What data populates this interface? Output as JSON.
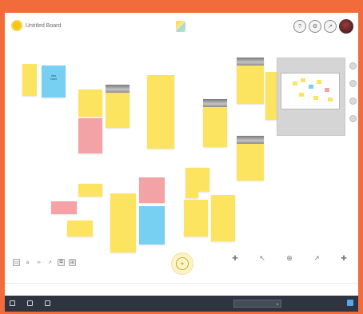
{
  "header": {
    "board_name": "Untitled Board",
    "logo_icon": "smiley-logo-icon",
    "center_logo_icon": "sticky-notes-app-icon",
    "buttons": [
      {
        "name": "help-icon",
        "glyph": "?"
      },
      {
        "name": "settings-icon",
        "glyph": "⚙"
      },
      {
        "name": "share-icon",
        "glyph": "↗"
      }
    ],
    "avatar": "user-avatar"
  },
  "canvas": {
    "notes": [
      {
        "id": "n1",
        "color": "yellow",
        "lines": [
          "",
          "",
          ""
        ]
      },
      {
        "id": "n2",
        "color": "blue",
        "lines": [
          "Idea",
          "board",
          ""
        ]
      },
      {
        "id": "n3",
        "color": "yellow",
        "lines": [
          "",
          "",
          "",
          ""
        ]
      },
      {
        "id": "n4",
        "color": "yellow",
        "lines": [
          "",
          "",
          ""
        ]
      },
      {
        "id": "n5",
        "color": "pink",
        "lines": [
          "",
          "",
          "",
          ""
        ]
      },
      {
        "id": "n6",
        "color": "yellow",
        "lines": [
          "",
          "",
          "",
          "",
          "",
          ""
        ]
      },
      {
        "id": "n7",
        "color": "yellow",
        "lines": [
          "",
          "",
          ""
        ]
      },
      {
        "id": "n8",
        "color": "yellow",
        "lines": [
          "",
          "",
          "",
          ""
        ]
      },
      {
        "id": "n9",
        "color": "yellow",
        "lines": [
          "",
          "",
          ""
        ]
      },
      {
        "id": "n10",
        "color": "yellow",
        "lines": [
          "",
          "",
          ""
        ]
      },
      {
        "id": "n11",
        "color": "yellow",
        "lines": [
          "",
          ""
        ]
      },
      {
        "id": "n12",
        "color": "pink",
        "lines": [
          ""
        ]
      },
      {
        "id": "n13",
        "color": "yellow",
        "lines": [
          ""
        ]
      },
      {
        "id": "n14",
        "color": "yellow",
        "lines": [
          "",
          "",
          "",
          "",
          ""
        ]
      },
      {
        "id": "n15",
        "color": "pink",
        "lines": [
          "",
          ""
        ]
      },
      {
        "id": "n16",
        "color": "blue",
        "lines": [
          "",
          "",
          ""
        ]
      },
      {
        "id": "n17",
        "color": "yellow",
        "lines": [
          "",
          "",
          ""
        ]
      },
      {
        "id": "n18",
        "color": "yellow",
        "lines": [
          "",
          "",
          ""
        ]
      },
      {
        "id": "n19",
        "color": "yellow",
        "lines": [
          "",
          "",
          ""
        ]
      },
      {
        "id": "n20",
        "color": "yellow",
        "lines": [
          "",
          ""
        ]
      },
      {
        "id": "n21",
        "color": "yellow",
        "lines": [
          "",
          ""
        ]
      }
    ],
    "minimap": "board-overview-minimap",
    "side_tools": [
      "zoom-in-icon",
      "zoom-out-icon",
      "fit-icon",
      "collapse-icon"
    ]
  },
  "toolbar": {
    "tools": [
      {
        "name": "select-tool-icon",
        "glyph": "▭"
      },
      {
        "name": "text-tool-icon",
        "glyph": "a"
      },
      {
        "name": "link-tool-icon",
        "glyph": "∞"
      },
      {
        "name": "arrow-tool-icon",
        "glyph": "↗"
      },
      {
        "name": "group-tool-icon",
        "glyph": "⧉"
      },
      {
        "name": "grid-tool-icon",
        "glyph": "⊞"
      }
    ],
    "add_button": "+",
    "actions": [
      {
        "name": "action-1",
        "glyph": "✚",
        "label": ""
      },
      {
        "name": "action-2",
        "glyph": "↖",
        "label": ""
      },
      {
        "name": "action-3",
        "glyph": "⊕",
        "label": ""
      },
      {
        "name": "action-4",
        "glyph": "↗",
        "label": ""
      },
      {
        "name": "action-5",
        "glyph": "✚",
        "label": ""
      }
    ]
  },
  "status": {
    "left": "",
    "middle": "",
    "right": ""
  },
  "taskbar": {
    "items": [
      {
        "name": "taskbar-item-1",
        "label": ""
      },
      {
        "name": "taskbar-item-2",
        "label": ""
      },
      {
        "name": "taskbar-item-3",
        "label": ""
      }
    ],
    "select_value": "",
    "right_label": "",
    "right_label_2": ""
  },
  "colors": {
    "app_background": "#f26b3a",
    "note_yellow": "#fce460",
    "note_blue": "#77cff2",
    "note_pink": "#f3a2a6",
    "taskbar": "#2e3440",
    "accent_toggle": "#52a8f0"
  }
}
